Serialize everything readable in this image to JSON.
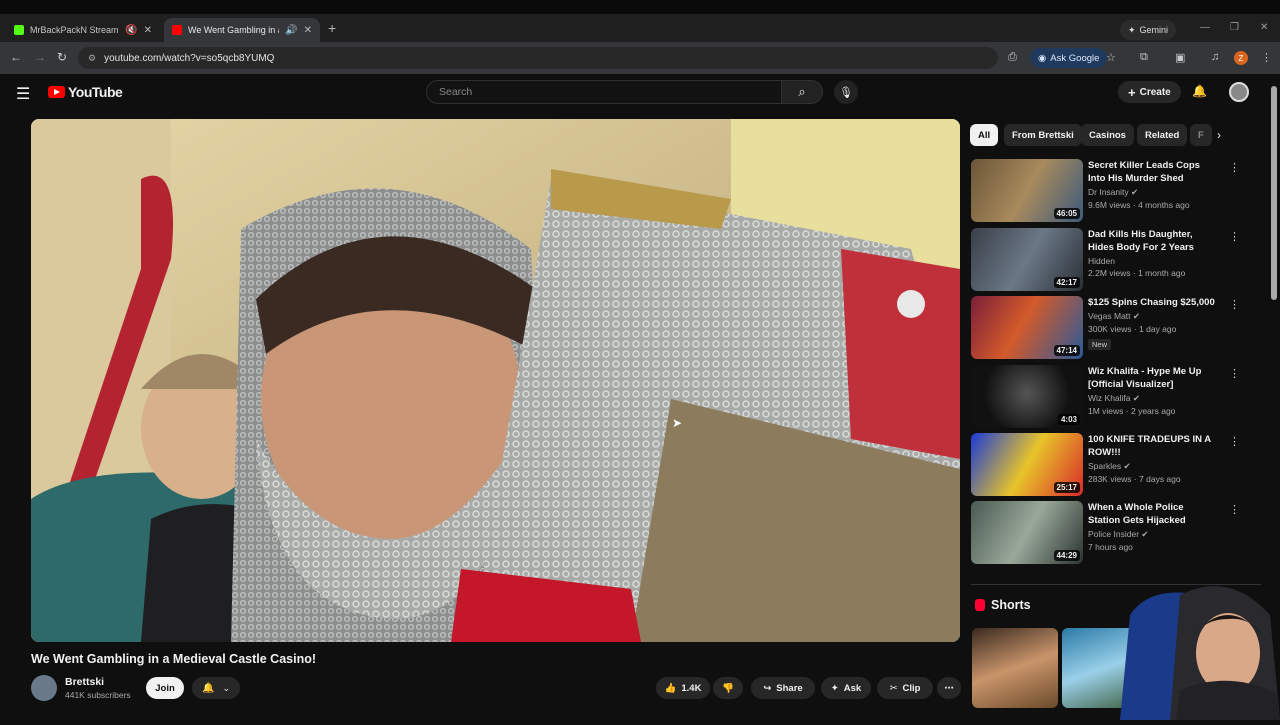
{
  "browser": {
    "tabs": [
      {
        "title": "MrBackPackN Stream - Wa",
        "favicon_color": "#53fc18"
      },
      {
        "title": "We Went Gambling in a Me",
        "favicon_color": "#ff0000"
      }
    ],
    "gemini_label": "Gemini",
    "url": "youtube.com/watch?v=so5qcb8YUMQ",
    "ask_google_label": "Ask Google",
    "profile_initial": "Z"
  },
  "masthead": {
    "logo_text": "YouTube",
    "search_placeholder": "Search",
    "create_label": "Create"
  },
  "video": {
    "title": "We Went Gambling in a Medieval Castle Casino!",
    "channel": "Brettski",
    "subscribers": "441K subscribers",
    "join_label": "Join",
    "likes": "1.4K",
    "share_label": "Share",
    "ask_label": "Ask",
    "clip_label": "Clip"
  },
  "chips": [
    "All",
    "From Brettski",
    "Casinos",
    "Related",
    "F"
  ],
  "recommendations": [
    {
      "title": "Secret Killer Leads Cops Into His Murder Shed",
      "channel": "Dr Insanity",
      "verified": true,
      "views": "9.6M views · 4 months ago",
      "duration": "46:05",
      "badge": ""
    },
    {
      "title": "Dad Kills His Daughter, Hides Body For 2 Years",
      "channel": "Hidden",
      "verified": false,
      "views": "2.2M views · 1 month ago",
      "duration": "42:17",
      "badge": ""
    },
    {
      "title": "$125 Spins Chasing $25,000",
      "channel": "Vegas Matt",
      "verified": true,
      "views": "300K views · 1 day ago",
      "duration": "47:14",
      "badge": "New"
    },
    {
      "title": "Wiz Khalifa - Hype Me Up [Official Visualizer]",
      "channel": "Wiz Khalifa",
      "verified": true,
      "views": "1M views · 2 years ago",
      "duration": "4:03",
      "badge": ""
    },
    {
      "title": "100 KNIFE TRADEUPS IN A ROW!!!",
      "channel": "Sparkles",
      "verified": true,
      "views": "283K views · 7 days ago",
      "duration": "25:17",
      "badge": ""
    },
    {
      "title": "When a Whole Police Station Gets Hijacked",
      "channel": "Police Insider",
      "verified": true,
      "views": "7 hours ago",
      "duration": "44:29",
      "badge": ""
    }
  ],
  "shorts_heading": "Shorts",
  "colors": {
    "accent": "#ff0000",
    "background": "#0f0f0f",
    "chip": "#272727"
  }
}
